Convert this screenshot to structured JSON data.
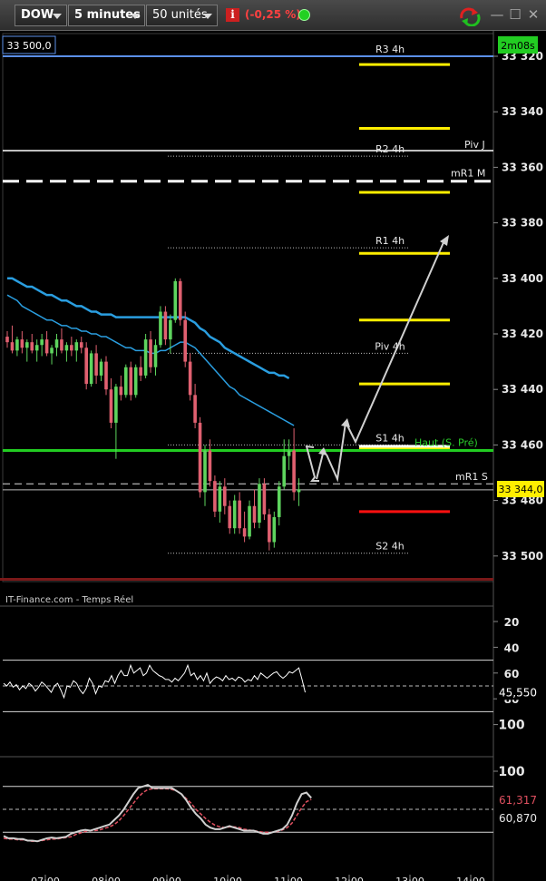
{
  "toolbar": {
    "instrument": "DOW",
    "interval": "5 minutes",
    "units": "50 unités",
    "change": "(-0,25 %)",
    "info_icon": "info-icon",
    "status_color": "#22d022",
    "minimize": "—",
    "maximize": "☐",
    "close": "✕"
  },
  "main": {
    "crosshair_price": "33 500,0",
    "timer": "2m08s",
    "last_price": "33 344,0",
    "source": "IT-Finance.com - Temps Réel",
    "pivot_labels": [
      "R3 4h",
      "R2 4h",
      "R1 4h",
      "Piv 4h",
      "S1 4h",
      "S2 4h"
    ],
    "line_labels": [
      "Piv J",
      "mR1 M",
      "Haut (S. Pré)",
      "mR1 S"
    ],
    "y_ticks": [
      "33 500",
      "33 480",
      "33 460",
      "33 440",
      "33 420",
      "33 400",
      "33 380",
      "33 360",
      "33 340",
      "33 320"
    ],
    "x_ticks": [
      "07:00",
      "08:00",
      "09:00",
      "10:00",
      "11:00",
      "12:00",
      "13:00",
      "14:00"
    ]
  },
  "osc1": {
    "ticks": [
      "100",
      "80",
      "60",
      "40",
      "20"
    ],
    "value": "45,550"
  },
  "osc2": {
    "ticks": [
      "100"
    ],
    "value_k": "61,317",
    "value_d": "60,870"
  },
  "colors": {
    "up": "#5ed45e",
    "down": "#e06070",
    "ma": "#2a9ee0",
    "level_yellow": "#ffee00",
    "level_red": "#ff1010",
    "level_green": "#22cc22",
    "level_blue": "#5b8fe8"
  },
  "chart_data": [
    {
      "type": "candlestick",
      "instrument": "DOW",
      "interval": "5 minutes",
      "ylim": [
        33308,
        33508
      ],
      "y_ticks": [
        33320,
        33340,
        33360,
        33380,
        33400,
        33420,
        33440,
        33460,
        33480,
        33500
      ],
      "x_ticks": [
        "07:00",
        "08:00",
        "09:00",
        "10:00",
        "11:00",
        "12:00",
        "13:00",
        "14:00"
      ],
      "candles": [
        [
          33399,
          33401,
          33395,
          33397
        ],
        [
          33397,
          33403,
          33393,
          33394
        ],
        [
          33394,
          33399,
          33392,
          33398
        ],
        [
          33398,
          33401,
          33393,
          33395
        ],
        [
          33395,
          33398,
          33390,
          33397
        ],
        [
          33397,
          33400,
          33393,
          33394
        ],
        [
          33394,
          33398,
          33390,
          33396
        ],
        [
          33396,
          33400,
          33392,
          33398
        ],
        [
          33398,
          33401,
          33392,
          33393
        ],
        [
          33393,
          33396,
          33389,
          33395
        ],
        [
          33395,
          33400,
          33392,
          33398
        ],
        [
          33398,
          33402,
          33393,
          33394
        ],
        [
          33394,
          33397,
          33390,
          33396
        ],
        [
          33396,
          33399,
          33392,
          33394
        ],
        [
          33394,
          33398,
          33390,
          33397
        ],
        [
          33397,
          33399,
          33393,
          33395
        ],
        [
          33395,
          33397,
          33380,
          33382
        ],
        [
          33382,
          33394,
          33381,
          33393
        ],
        [
          33393,
          33396,
          33382,
          33385
        ],
        [
          33385,
          33391,
          33383,
          33390
        ],
        [
          33390,
          33392,
          33378,
          33380
        ],
        [
          33380,
          33384,
          33366,
          33368
        ],
        [
          33368,
          33382,
          33355,
          33381
        ],
        [
          33381,
          33385,
          33376,
          33378
        ],
        [
          33378,
          33389,
          33377,
          33388
        ],
        [
          33388,
          33390,
          33376,
          33378
        ],
        [
          33378,
          33389,
          33377,
          33388
        ],
        [
          33388,
          33392,
          33383,
          33385
        ],
        [
          33385,
          33400,
          33384,
          33398
        ],
        [
          33398,
          33401,
          33386,
          33388
        ],
        [
          33388,
          33398,
          33385,
          33396
        ],
        [
          33396,
          33410,
          33395,
          33408
        ],
        [
          33408,
          33410,
          33396,
          33398
        ],
        [
          33398,
          33407,
          33393,
          33405
        ],
        [
          33405,
          33420,
          33404,
          33419
        ],
        [
          33419,
          33420,
          33403,
          33405
        ],
        [
          33405,
          33408,
          33388,
          33390
        ],
        [
          33390,
          33393,
          33376,
          33378
        ],
        [
          33378,
          33382,
          33366,
          33368
        ],
        [
          33368,
          33370,
          33341,
          33343
        ],
        [
          33343,
          33360,
          33338,
          33358
        ],
        [
          33358,
          33362,
          33345,
          33347
        ],
        [
          33347,
          33349,
          33334,
          33336
        ],
        [
          33336,
          33347,
          33332,
          33345
        ],
        [
          33345,
          33348,
          33335,
          33338
        ],
        [
          33338,
          33340,
          33328,
          33330
        ],
        [
          33330,
          33342,
          33328,
          33340
        ],
        [
          33340,
          33343,
          33328,
          33330
        ],
        [
          33330,
          33336,
          33325,
          33327
        ],
        [
          33327,
          33340,
          33326,
          33338
        ],
        [
          33338,
          33344,
          33330,
          33332
        ],
        [
          33332,
          33348,
          33330,
          33346
        ],
        [
          33346,
          33348,
          33333,
          33335
        ],
        [
          33335,
          33337,
          33322,
          33325
        ],
        [
          33325,
          33336,
          33323,
          33334
        ],
        [
          33334,
          33347,
          33331,
          33345
        ],
        [
          33345,
          33362,
          33344,
          33356
        ],
        [
          33356,
          33362,
          33351,
          33358
        ],
        [
          33358,
          33366,
          33340,
          33343
        ],
        [
          33343,
          33348,
          33338,
          33344
        ]
      ],
      "ma_fast": [
        33414,
        33413,
        33412,
        33410,
        33409,
        33408,
        33407,
        33406,
        33405,
        33405,
        33404,
        33403,
        33403,
        33402,
        33402,
        33401,
        33401,
        33400,
        33400,
        33399,
        33399,
        33398,
        33397,
        33396,
        33395,
        33395,
        33394,
        33394,
        33394,
        33393,
        33393,
        33394,
        33394,
        33395,
        33396,
        33397,
        33397,
        33396,
        33395,
        33393,
        33391,
        33389,
        33387,
        33385,
        33383,
        33381,
        33380,
        33378,
        33377,
        33376,
        33375,
        33374,
        33373,
        33372,
        33371,
        33370,
        33369,
        33368,
        33367
      ],
      "ma_slow": [
        33420,
        33420,
        33419,
        33418,
        33417,
        33417,
        33416,
        33415,
        33414,
        33414,
        33413,
        33412,
        33412,
        33411,
        33410,
        33410,
        33409,
        33408,
        33408,
        33407,
        33407,
        33407,
        33406,
        33406,
        33406,
        33406,
        33406,
        33406,
        33406,
        33406,
        33406,
        33406,
        33406,
        33406,
        33406,
        33406,
        33406,
        33405,
        33404,
        33402,
        33401,
        33399,
        33398,
        33397,
        33395,
        33394,
        33393,
        33392,
        33391,
        33390,
        33389,
        33388,
        33387,
        33386,
        33386,
        33385,
        33385,
        33384
      ],
      "pivots_4h": {
        "R3 4h": 33500,
        "R2 4h": 33464,
        "R1 4h": 33431,
        "Piv 4h": 33393,
        "S1 4h": 33360,
        "S2 4h": 33321
      },
      "levels": {
        "Piv J": 33466,
        "mR1 M": 33455,
        "Haut (S. Pré)": 33358,
        "mR1 S": 33346,
        "crosshair": 33500
      },
      "forecast_levels": [
        33497,
        33474,
        33451,
        33429,
        33405,
        33382,
        33359,
        33336
      ],
      "last_price": 33344.0
    },
    {
      "type": "line",
      "name": "oscillator 1",
      "ylim": [
        0,
        110
      ],
      "y_ticks": [
        20,
        40,
        60,
        80,
        100
      ],
      "bands": [
        30,
        70
      ],
      "midline": 50,
      "values": [
        52,
        50,
        53,
        49,
        51,
        47,
        50,
        48,
        52,
        50,
        46,
        49,
        53,
        51,
        48,
        45,
        50,
        52,
        47,
        41,
        50,
        49,
        54,
        52,
        47,
        44,
        48,
        56,
        52,
        44,
        50,
        49,
        54,
        53,
        58,
        52,
        58,
        62,
        58,
        58,
        66,
        60,
        62,
        64,
        58,
        60,
        66,
        62,
        60,
        58,
        57,
        55,
        55,
        53,
        56,
        54,
        57,
        60,
        66,
        58,
        60,
        55,
        58,
        54,
        60,
        52,
        55,
        57,
        56,
        54,
        58,
        55,
        56,
        54,
        57,
        56,
        53,
        55,
        54,
        58,
        55,
        60,
        58,
        56,
        58,
        60,
        61,
        58,
        56,
        58,
        61,
        60,
        62,
        64,
        55,
        45
      ],
      "last_value": 45.55
    },
    {
      "type": "line",
      "name": "oscillator 2",
      "ylim": [
        0,
        115
      ],
      "y_ticks": [
        100
      ],
      "bands": [
        20,
        80
      ],
      "midline": 50,
      "series_k": [
        15,
        12,
        12,
        11,
        11,
        9,
        9,
        8,
        10,
        12,
        13,
        12,
        13,
        14,
        18,
        20,
        22,
        23,
        22,
        24,
        26,
        28,
        30,
        36,
        42,
        50,
        60,
        70,
        78,
        80,
        82,
        78,
        78,
        78,
        78,
        78,
        74,
        70,
        62,
        52,
        44,
        38,
        30,
        26,
        24,
        24,
        26,
        28,
        26,
        24,
        22,
        22,
        22,
        20,
        18,
        18,
        20,
        22,
        24,
        30,
        42,
        58,
        70,
        72,
        65
      ],
      "series_d": [
        12,
        11,
        11,
        10,
        10,
        9,
        8,
        8,
        9,
        10,
        11,
        11,
        12,
        13,
        14,
        17,
        19,
        21,
        22,
        22,
        23,
        25,
        27,
        30,
        35,
        42,
        50,
        58,
        66,
        72,
        76,
        77,
        77,
        77,
        77,
        76,
        74,
        70,
        64,
        58,
        50,
        44,
        38,
        33,
        29,
        27,
        26,
        27,
        27,
        26,
        24,
        23,
        22,
        21,
        20,
        20,
        20,
        21,
        23,
        26,
        32,
        42,
        52,
        60,
        63
      ],
      "value_k": 61.317,
      "value_d": 60.87
    }
  ]
}
